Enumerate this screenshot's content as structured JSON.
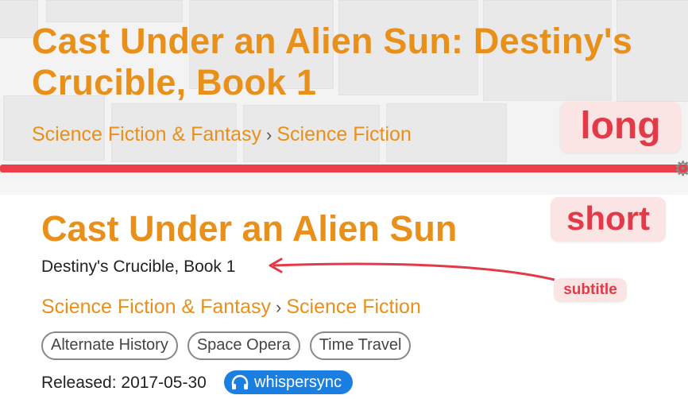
{
  "long_example": {
    "title": "Cast Under an Alien Sun: Destiny's Crucible, Book 1",
    "breadcrumb": [
      "Science Fiction & Fantasy",
      "Science Fiction"
    ],
    "label": "long"
  },
  "short_example": {
    "title": "Cast Under an Alien Sun",
    "subtitle": "Destiny's Crucible, Book 1",
    "breadcrumb": [
      "Science Fiction & Fantasy",
      "Science Fiction"
    ],
    "label": "short",
    "subtitle_label": "subtitle",
    "tags": [
      "Alternate History",
      "Space Opera",
      "Time Travel"
    ],
    "released": "Released: 2017-05-30",
    "badge": "whispersync"
  },
  "breadcrumb_separator": "›",
  "colors": {
    "title": "#e8901a",
    "annotation": "#e23a48",
    "annotation_bg": "#fbe4e4",
    "badge_bg": "#1a7fe0"
  },
  "icons": [
    "chevron-right-icon",
    "headphones-icon",
    "gear-icon",
    "arrow-icon"
  ]
}
